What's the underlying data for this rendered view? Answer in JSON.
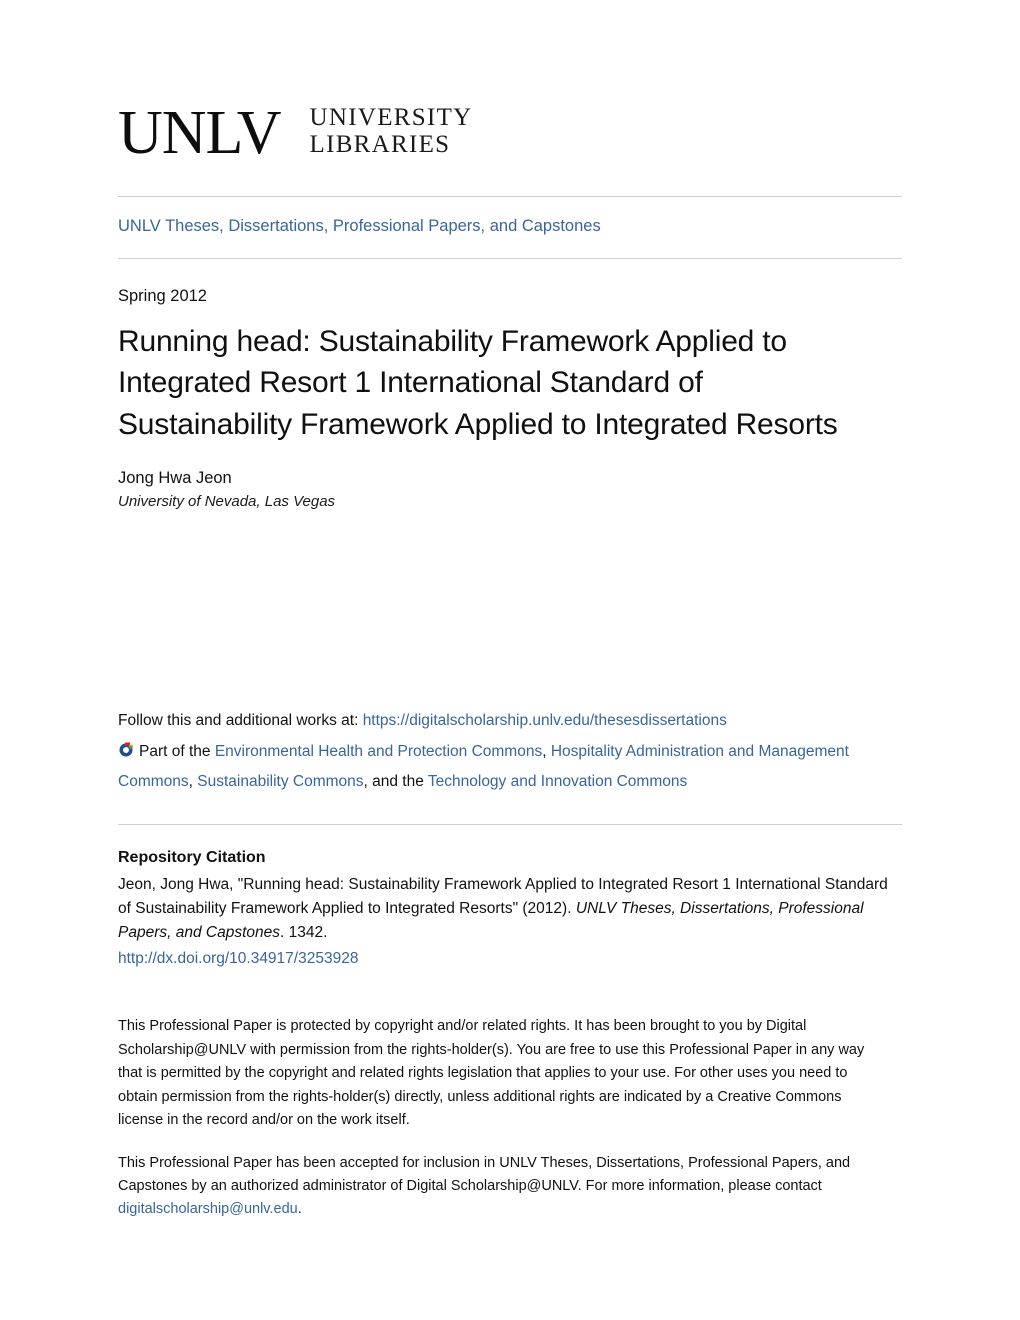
{
  "logo": {
    "wordmark": "UNLV",
    "lockup_line1": "UNIVERSITY",
    "lockup_line2": "LIBRARIES",
    "icon_name": "unlv-libraries-logo"
  },
  "collection": {
    "label": "UNLV Theses, Dissertations, Professional Papers, and Capstones"
  },
  "publication": {
    "date": "Spring 2012",
    "title": "Running head: Sustainability Framework Applied to Integrated Resort 1 International Standard of Sustainability Framework Applied to Integrated Resorts"
  },
  "author": {
    "name": "Jong Hwa Jeon",
    "affiliation": "University of Nevada, Las Vegas"
  },
  "follow": {
    "prefix": "Follow this and additional works at: ",
    "url_label": "https://digitalscholarship.unlv.edu/thesesdissertations",
    "icon_name": "digital-commons-network-icon",
    "part_of_label": "Part of the ",
    "disciplines": [
      {
        "label": "Environmental Health and Protection Commons",
        "separator": ", "
      },
      {
        "label": "Hospitality Administration and Management Commons",
        "separator": ", "
      },
      {
        "label": "Sustainability Commons",
        "separator": ", and the "
      },
      {
        "label": "Technology and Innovation Commons",
        "separator": ""
      }
    ]
  },
  "citation": {
    "heading": "Repository Citation",
    "part1": "Jeon, Jong Hwa, \"Running head: Sustainability Framework Applied to Integrated Resort 1 International Standard of Sustainability Framework Applied to Integrated Resorts\" (2012). ",
    "italic_part": "UNLV Theses, Dissertations, Professional Papers, and Capstones",
    "part2": ". 1342.",
    "doi_label": "http://dx.doi.org/10.34917/3253928"
  },
  "rights": {
    "paragraph1": "This Professional Paper is protected by copyright and/or related rights. It has been brought to you by Digital Scholarship@UNLV with permission from the rights-holder(s). You are free to use this Professional Paper in any way that is permitted by the copyright and related rights legislation that applies to your use. For other uses you need to obtain permission from the rights-holder(s) directly, unless additional rights are indicated by a Creative Commons license in the record and/or on the work itself.",
    "paragraph2_part1": "This Professional Paper has been accepted for inclusion in UNLV Theses, Dissertations, Professional Papers, and Capstones by an authorized administrator of Digital Scholarship@UNLV. For more information, please contact ",
    "contact_email": "digitalscholarship@unlv.edu",
    "paragraph2_part2": "."
  },
  "colors": {
    "link_blue": "#38659b",
    "rule_gray": "#cfcfcf",
    "text_black": "#111111"
  }
}
